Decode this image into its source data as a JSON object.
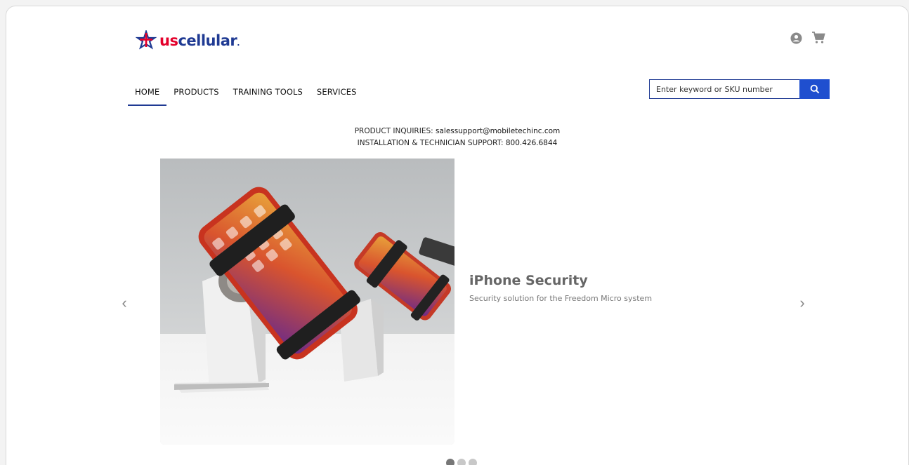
{
  "brand": {
    "logo_us": "us",
    "logo_cellular": "cellular",
    "logo_mark": ".",
    "colors": {
      "red": "#e4002b",
      "blue": "#1f3a93",
      "button": "#1f4fcf"
    }
  },
  "header": {
    "icons": [
      "account-icon",
      "cart-icon"
    ]
  },
  "nav": {
    "items": [
      {
        "label": "HOME",
        "active": true
      },
      {
        "label": "PRODUCTS",
        "active": false
      },
      {
        "label": "TRAINING TOOLS",
        "active": false
      },
      {
        "label": "SERVICES",
        "active": false
      }
    ]
  },
  "search": {
    "placeholder": "Enter keyword or SKU number",
    "value": ""
  },
  "contact": {
    "inquiries_label": "PRODUCT INQUIRIES: ",
    "inquiries_email": "salessupport@mobiletechinc.com",
    "support_label": "INSTALLATION & TECHNICIAN SUPPORT: ",
    "support_phone": "800.426.6844"
  },
  "carousel": {
    "title": "iPhone Security",
    "subtitle": "Security solution for the Freedom Micro system",
    "prev": "‹",
    "next": "›",
    "slide_count": 3,
    "active_index": 0
  }
}
